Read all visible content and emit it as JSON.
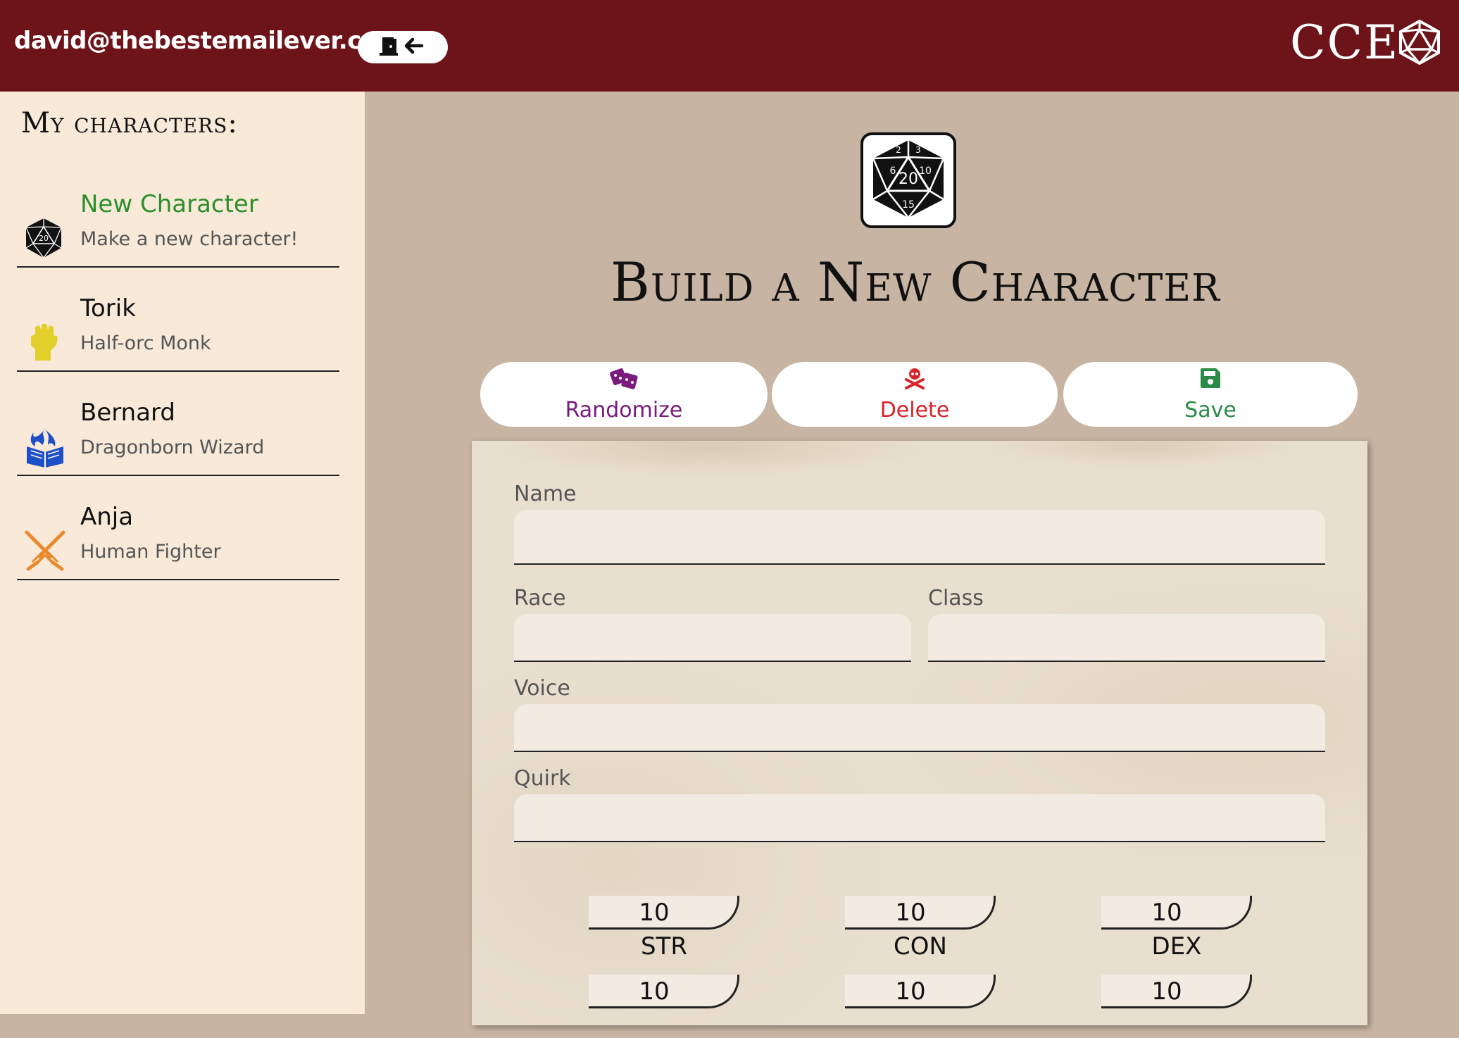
{
  "header": {
    "user_email": "david@thebestemailever.com",
    "logout_icon": "logout-door-arrow-icon",
    "brand": "CCE",
    "brand_icon": "d20-icon"
  },
  "sidebar": {
    "title": "My characters:",
    "items": [
      {
        "name": "New Character",
        "desc": "Make a new character!",
        "icon": "d20-icon",
        "color": "#2c8f2c"
      },
      {
        "name": "Torik",
        "desc": "Half-orc Monk",
        "icon": "fist-icon",
        "color": "#e3cf2a"
      },
      {
        "name": "Bernard",
        "desc": "Dragonborn Wizard",
        "icon": "spellbook-icon",
        "color": "#1f4fc8"
      },
      {
        "name": "Anja",
        "desc": "Human Fighter",
        "icon": "crossed-swords-icon",
        "color": "#e88a2c"
      }
    ]
  },
  "main": {
    "logo_icon": "d20-icon",
    "title": "Build a New Character",
    "buttons": {
      "randomize": "Randomize",
      "delete": "Delete",
      "save": "Save"
    },
    "button_colors": {
      "randomize": "#7a1a7e",
      "delete": "#d8232a",
      "save": "#2c8a48"
    },
    "form": {
      "name_label": "Name",
      "name_value": "",
      "race_label": "Race",
      "race_value": "",
      "class_label": "Class",
      "class_value": "",
      "voice_label": "Voice",
      "voice_value": "",
      "quirk_label": "Quirk",
      "quirk_value": ""
    },
    "stats": [
      {
        "label": "STR",
        "value": "10"
      },
      {
        "label": "CON",
        "value": "10"
      },
      {
        "label": "DEX",
        "value": "10"
      },
      {
        "label": "",
        "value": "10"
      },
      {
        "label": "",
        "value": "10"
      },
      {
        "label": "",
        "value": "10"
      }
    ]
  }
}
